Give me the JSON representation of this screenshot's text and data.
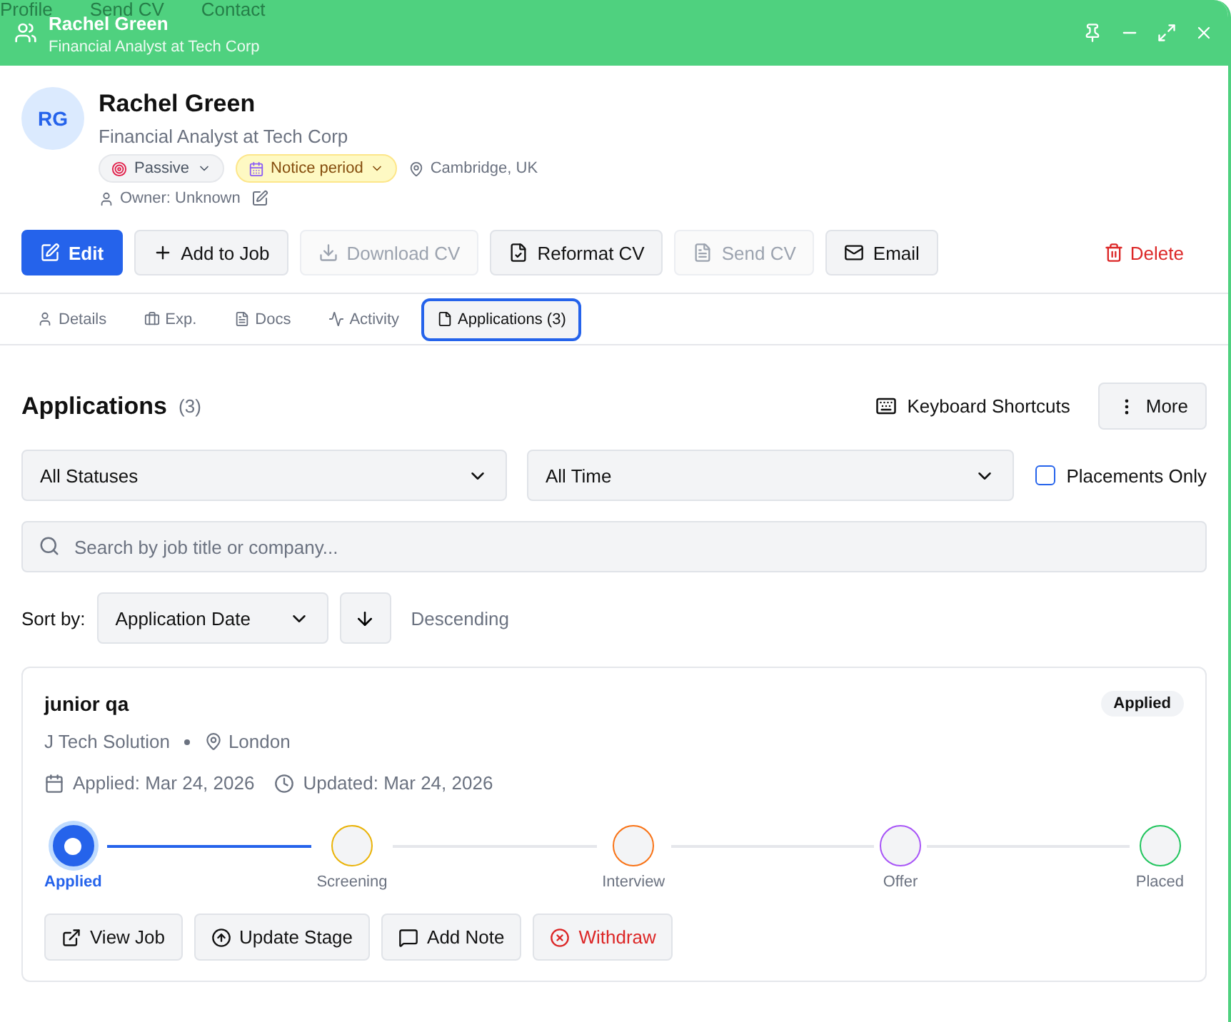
{
  "background_tabs": [
    "Profile",
    "Send CV",
    "Contact"
  ],
  "window": {
    "title": "Rachel Green",
    "subtitle": "Financial Analyst at Tech Corp"
  },
  "profile": {
    "initials": "RG",
    "name": "Rachel Green",
    "headline": "Financial Analyst at Tech Corp",
    "tags": [
      {
        "kind": "status",
        "label": "Passive"
      },
      {
        "kind": "availability",
        "label": "Notice period"
      }
    ],
    "location": "Cambridge, UK",
    "owner": "Owner: Unknown"
  },
  "actions": [
    {
      "kind": "primary",
      "label": "Edit",
      "disabled": false
    },
    {
      "kind": "plus",
      "label": "Add to Job",
      "disabled": false
    },
    {
      "kind": "download",
      "label": "Download CV",
      "disabled": true
    },
    {
      "kind": "reformat",
      "label": "Reformat CV",
      "disabled": false
    },
    {
      "kind": "send",
      "label": "Send CV",
      "disabled": true
    },
    {
      "kind": "email",
      "label": "Email",
      "disabled": false
    }
  ],
  "delete_label": "Delete",
  "tabs": [
    {
      "kind": "user",
      "label": "Details",
      "selected": false
    },
    {
      "kind": "briefcase",
      "label": "Exp.",
      "selected": false
    },
    {
      "kind": "doc",
      "label": "Docs",
      "selected": false
    },
    {
      "kind": "activity",
      "label": "Activity",
      "selected": false
    },
    {
      "kind": "file",
      "label": "Applications (3)",
      "selected": true
    }
  ],
  "applications": {
    "title": "Applications",
    "count": "(3)",
    "shortcuts": "Keyboard Shortcuts",
    "more": "More",
    "status_filter": "All Statuses",
    "time_filter": "All Time",
    "placements_only": {
      "label": "Placements Only",
      "checked": false
    },
    "search": {
      "placeholder": "Search by job title or company..."
    },
    "sort_label": "Sort by:",
    "sort_value": "Application Date",
    "sort_direction": "Descending",
    "cards": [
      {
        "title": "junior qa",
        "status": "Applied",
        "company": "J Tech Solution",
        "location": "London",
        "applied": "Applied: Mar 24, 2026",
        "updated": "Updated: Mar 24, 2026",
        "stages": [
          {
            "label": "Applied",
            "color": "#2563eb",
            "selected": true
          },
          {
            "label": "Screening",
            "color": "#eab308",
            "selected": false
          },
          {
            "label": "Interview",
            "color": "#f97316",
            "selected": false
          },
          {
            "label": "Offer",
            "color": "#a855f7",
            "selected": false
          },
          {
            "label": "Placed",
            "color": "#22c55e",
            "selected": false
          }
        ],
        "buttons": [
          {
            "kind": "view",
            "label": "View Job"
          },
          {
            "kind": "update",
            "label": "Update Stage"
          },
          {
            "kind": "note",
            "label": "Add Note"
          },
          {
            "kind": "withdraw",
            "label": "Withdraw"
          }
        ]
      }
    ]
  }
}
